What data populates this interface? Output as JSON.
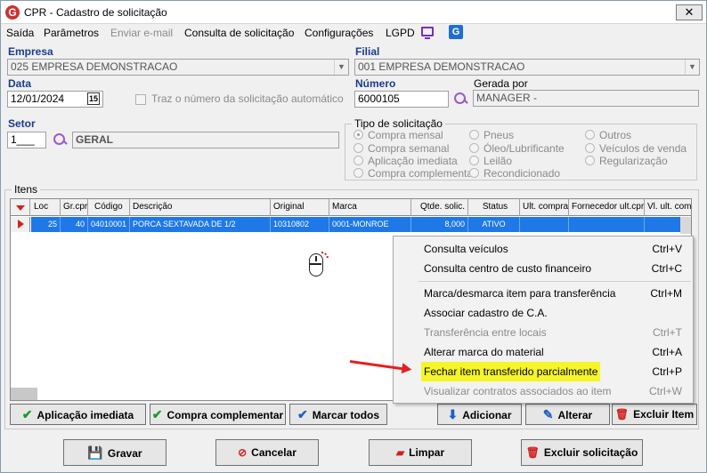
{
  "window": {
    "title": "CPR - Cadastro de solicitação",
    "close_label": "✕",
    "logo_letter": "G"
  },
  "menu": {
    "saida": "Saída",
    "parametros": "Parâmetros",
    "enviar_email": "Enviar e-mail",
    "consulta": "Consulta de solicitação",
    "configuracoes": "Configurações",
    "lgpd": "LGPD",
    "g_letter": "G"
  },
  "form": {
    "empresa_label": "Empresa",
    "empresa_value": "025 EMPRESA DEMONSTRACAO",
    "filial_label": "Filial",
    "filial_value": "001 EMPRESA DEMONSTRACAO",
    "data_label": "Data",
    "data_value": "12/01/2024",
    "cal_label": "15",
    "auto_number_label": "Traz o número da solicitação automático",
    "numero_label": "Número",
    "numero_value": "6000105",
    "gerada_label": "Gerada por",
    "gerada_value": "MANAGER -",
    "setor_label": "Setor",
    "setor_code": "1___",
    "setor_name": "GERAL"
  },
  "tipo": {
    "title": "Tipo de solicitação",
    "options": [
      "Compra mensal",
      "Compra semanal",
      "Aplicação imediata",
      "Compra complementar",
      "Pneus",
      "Óleo/Lubrificante",
      "Leilão",
      "Recondicionado",
      "Outros",
      "Veículos de venda",
      "Regularização"
    ]
  },
  "itens": {
    "title": "Itens",
    "columns": [
      "Loc",
      "Gr.cpr",
      "Código",
      "Descrição",
      "Original",
      "Marca",
      "Qtde. solic.",
      "Status",
      "Ult. compra",
      "Fornecedor ult.cpr",
      "Vl. ult. com"
    ],
    "row": [
      "25",
      "40",
      "04010001",
      "PORCA SEXTAVADA DE 1/2",
      "10310802",
      "0001-MONROE",
      "8,000",
      "ATIVO",
      "",
      "",
      ""
    ]
  },
  "context_menu": [
    {
      "label": "Consulta veículos",
      "shortcut": "Ctrl+V"
    },
    {
      "label": "Consulta centro de custo financeiro",
      "shortcut": "Ctrl+C"
    },
    {
      "label": "Marca/desmarca item para transferência",
      "shortcut": "Ctrl+M"
    },
    {
      "label": "Associar cadastro de C.A.",
      "shortcut": ""
    },
    {
      "label": "Transferência entre locais",
      "shortcut": "Ctrl+T"
    },
    {
      "label": "Alterar marca do material",
      "shortcut": "Ctrl+A"
    },
    {
      "label": "Fechar item transferido parcialmente",
      "shortcut": "Ctrl+P"
    },
    {
      "label": "Visualizar contratos associados ao item",
      "shortcut": "Ctrl+W"
    }
  ],
  "buttons": {
    "aplicacao": "Aplicação imediata",
    "compra_comp": "Compra complementar",
    "marcar": "Marcar todos",
    "adicionar": "Adicionar",
    "alterar": "Alterar",
    "excluir_item": "Excluir Item",
    "gravar": "Gravar",
    "cancelar": "Cancelar",
    "limpar": "Limpar",
    "excluir_sol": "Excluir solicitação"
  },
  "colors": {
    "highlight": "#f5f52a",
    "selected_row": "#1e78e8",
    "arrow": "#e62020"
  }
}
